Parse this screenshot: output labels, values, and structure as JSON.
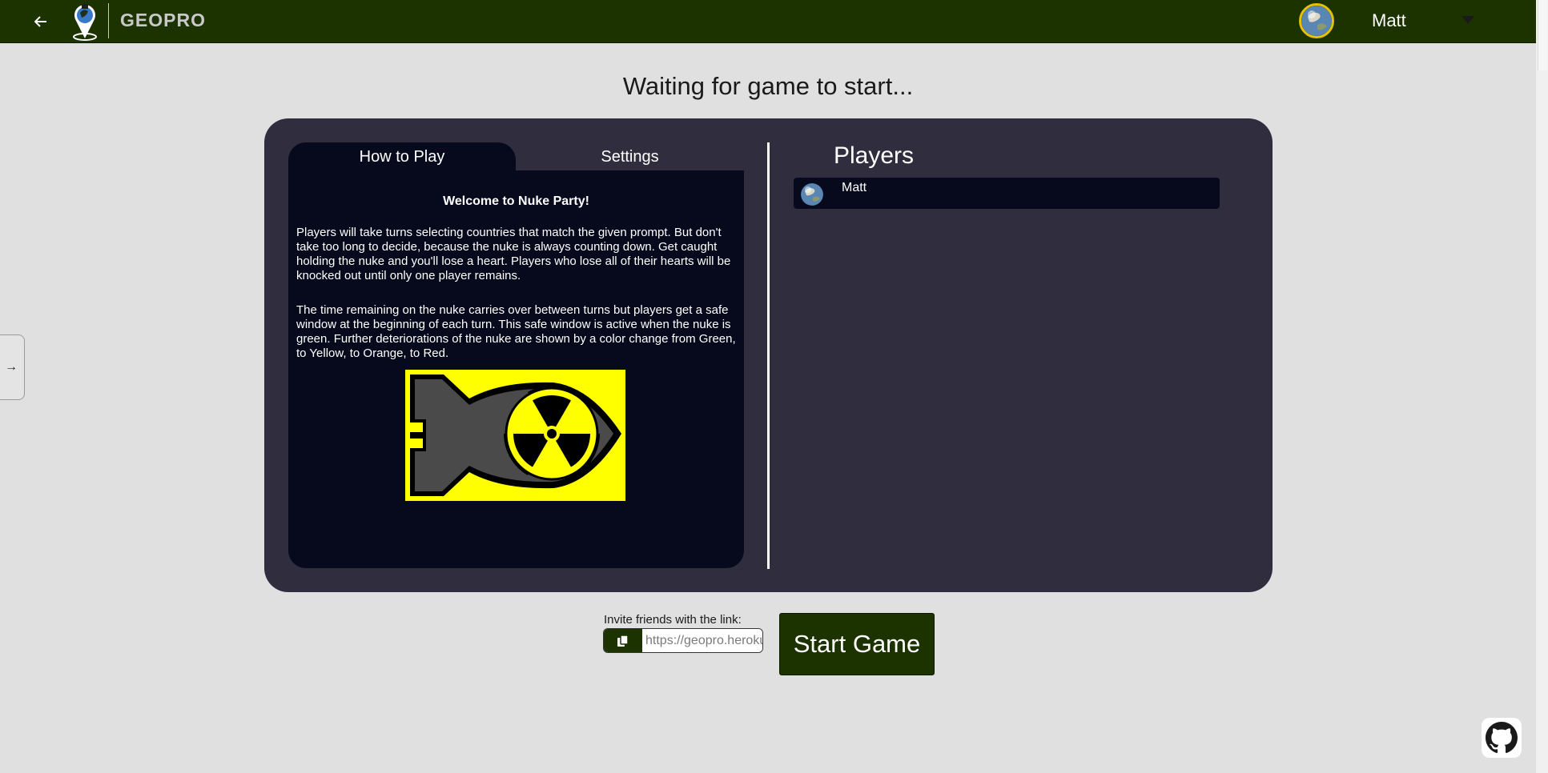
{
  "header": {
    "back_icon": "arrow-left-icon",
    "logo_text": "GEOPRO",
    "user_name": "Matt",
    "user_menu_icon": "caret-down-icon",
    "brand_color": "#1c3300",
    "avatar_ring_color": "#e6c200"
  },
  "side_toggle": {
    "label": "→"
  },
  "page": {
    "title": "Waiting for game to start..."
  },
  "tabs": [
    {
      "label": "How to Play",
      "active": true
    },
    {
      "label": "Settings",
      "active": false
    }
  ],
  "how_to_play": {
    "heading": "Welcome to Nuke Party!",
    "paragraph_1": "Players will take turns selecting countries that match the given prompt. But don't take too long to decide, because the nuke is always counting down. Get caught holding the nuke and you'll lose a heart. Players who lose all of their hearts will be knocked out until only one player remains.",
    "paragraph_2": "The time remaining on the nuke carries over between turns but players get a safe window at the beginning of each turn. This safe window is active when the nuke is green. Further deteriorations of the nuke are shown by a color change from Green, to Yellow, to Orange, to Red.",
    "image_icon": "nuke-bomb-icon"
  },
  "players": {
    "title": "Players",
    "list": [
      {
        "name": "Matt",
        "avatar_icon": "earth-globe-icon"
      }
    ]
  },
  "invite": {
    "label": "Invite friends with the link:",
    "link_value": "https://geopro.herokuapp.com",
    "copy_icon": "copy-icon"
  },
  "actions": {
    "start_label": "Start Game"
  },
  "footer": {
    "github_icon": "github-icon"
  },
  "colors": {
    "page_bg": "#e0e0e0",
    "panel_bg": "#302d3e",
    "inner_bg": "#070a1d",
    "nuke_bg": "#ffff00"
  }
}
